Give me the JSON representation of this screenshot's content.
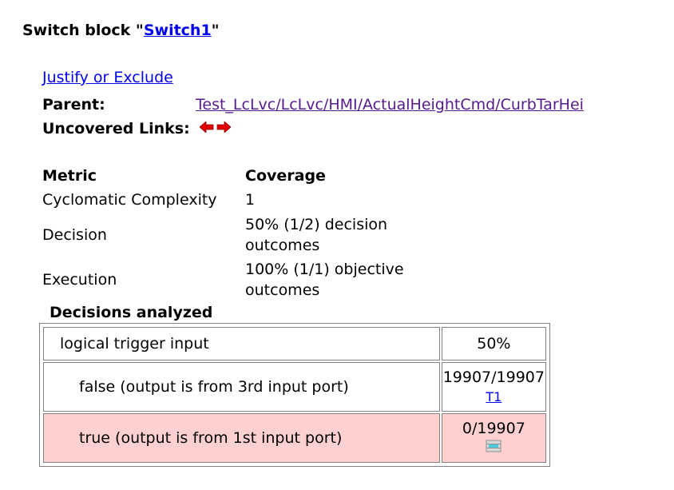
{
  "title": {
    "prefix": "Switch block \"",
    "link_text": "Switch1",
    "suffix": "\""
  },
  "justify_link": "Justify or Exclude",
  "parent": {
    "label": "Parent:",
    "path": "Test_LcLvc/LcLvc/HMI/ActualHeightCmd/CurbTarHei"
  },
  "uncovered_links": {
    "label": "Uncovered Links:",
    "icons": [
      "left-arrow-icon",
      "right-arrow-icon"
    ],
    "color": "#e00000"
  },
  "metrics": {
    "header": {
      "metric": "Metric",
      "coverage": "Coverage"
    },
    "rows": [
      {
        "metric": "Cyclomatic Complexity",
        "coverage": "1"
      },
      {
        "metric": "Decision",
        "coverage": "50% (1/2) decision outcomes"
      },
      {
        "metric": "Execution",
        "coverage": "100% (1/1) objective outcomes"
      }
    ]
  },
  "decisions": {
    "caption": "Decisions analyzed",
    "main": {
      "description": "logical trigger input",
      "coverage": "50%"
    },
    "outcomes": [
      {
        "description": "false (output is from 3rd input port)",
        "count": "19907/19907",
        "test": "T1",
        "covered": true
      },
      {
        "description": "true (output is from 1st input port)",
        "count": "0/19907",
        "icon": "not-covered-icon",
        "covered": false
      }
    ],
    "uncovered_color": "#ffd0d0"
  }
}
